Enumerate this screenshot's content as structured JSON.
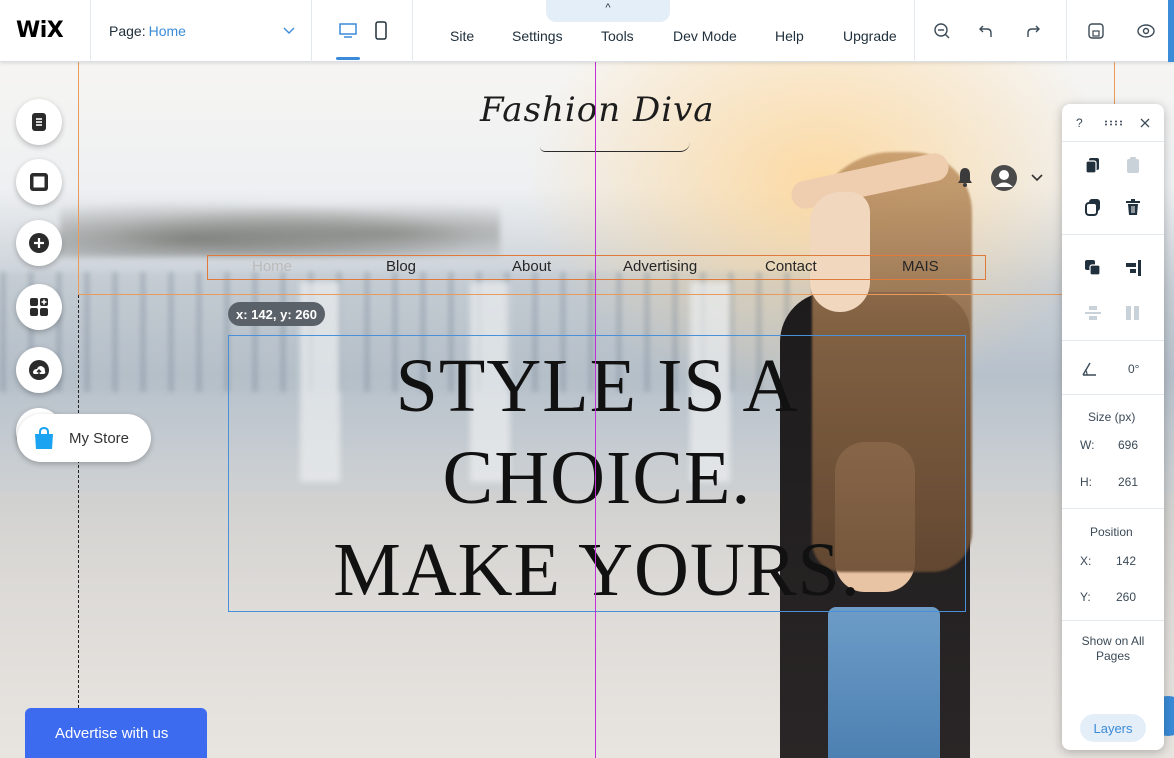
{
  "topbar": {
    "logo": "WiX",
    "page_label": "Page:",
    "page_value": "Home",
    "menu": [
      "Site",
      "Settings",
      "Tools",
      "Dev Mode",
      "Help",
      "Upgrade"
    ],
    "collapse_glyph": "^"
  },
  "site": {
    "logo_text": "Fashion Diva",
    "nav": [
      "Home",
      "Blog",
      "About",
      "Advertising",
      "Contact",
      "MAIS"
    ],
    "headline": [
      "STYLE IS A",
      "CHOICE.",
      "MAKE YOURS."
    ],
    "advertise_label": "Advertise with us"
  },
  "editor": {
    "coord_tag": "x: 142, y: 260",
    "store_label": "My Store"
  },
  "inspector": {
    "help": "?",
    "rotation_value": "0°",
    "size_title": "Size (px)",
    "w_label": "W:",
    "w_value": "696",
    "h_label": "H:",
    "h_value": "261",
    "position_title": "Position",
    "x_label": "X:",
    "x_value": "142",
    "y_label": "Y:",
    "y_value": "260",
    "show_all_pages": "Show on All Pages",
    "layers_label": "Layers"
  },
  "colors": {
    "accent": "#3a8bd8",
    "guide_magenta": "#c12fd6",
    "guide_orange": "#e89b5a",
    "advertise_bg": "#3d6bf0"
  }
}
